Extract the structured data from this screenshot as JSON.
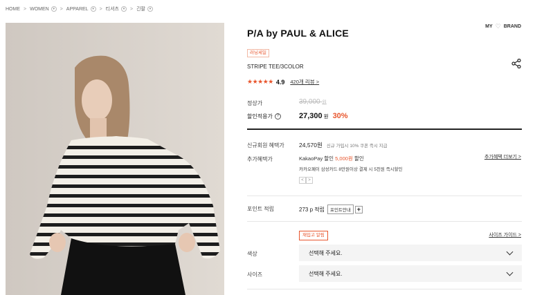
{
  "breadcrumb": {
    "items": [
      "HOME",
      "WOMEN",
      "APPAREL",
      "티셔츠",
      "긴팔"
    ],
    "separator": ">"
  },
  "header": {
    "brand": "P/A by PAUL & ALICE",
    "my_label": "MY",
    "brand_label": "BRAND"
  },
  "product": {
    "badge": "러닝세일",
    "name": "STRIPE TEE/3COLOR",
    "stars": "★★★★★",
    "score": "4.9",
    "review_link": "420개 리뷰 >"
  },
  "price": {
    "original_label": "정상가",
    "original": "39,000",
    "original_unit": "원",
    "sale_label": "할인적용가",
    "sale": "27,300",
    "sale_unit": "원",
    "discount": "30%"
  },
  "benefits": {
    "member_label": "신규회원 혜택가",
    "member_price": "24,570원",
    "member_note": "신규 가입시 10% 쿠폰 즉시 지급",
    "extra_label": "추가혜택가",
    "kakao_prefix": "KakaoPay 할인 ",
    "kakao_amount": "5,000원",
    "kakao_suffix": " 할인",
    "card_note": "카카오페이 삼성카드 8만원이상 결제 시 5천원 즉시할인",
    "more_link": "추가혜택 더보기 >",
    "pager_prev": "<",
    "pager_next": ">"
  },
  "points": {
    "label": "포인트 적립",
    "value": "273 p 적립",
    "guide": "포인트안내",
    "plus": "+"
  },
  "options": {
    "restock": "재입고 알림",
    "size_guide": "사이즈 가이드 >",
    "color_label": "색상",
    "color_placeholder": "선택해 주세요.",
    "size_label": "사이즈",
    "size_placeholder": "선택해 주세요."
  },
  "colors": {
    "accent": "#e8552c"
  }
}
